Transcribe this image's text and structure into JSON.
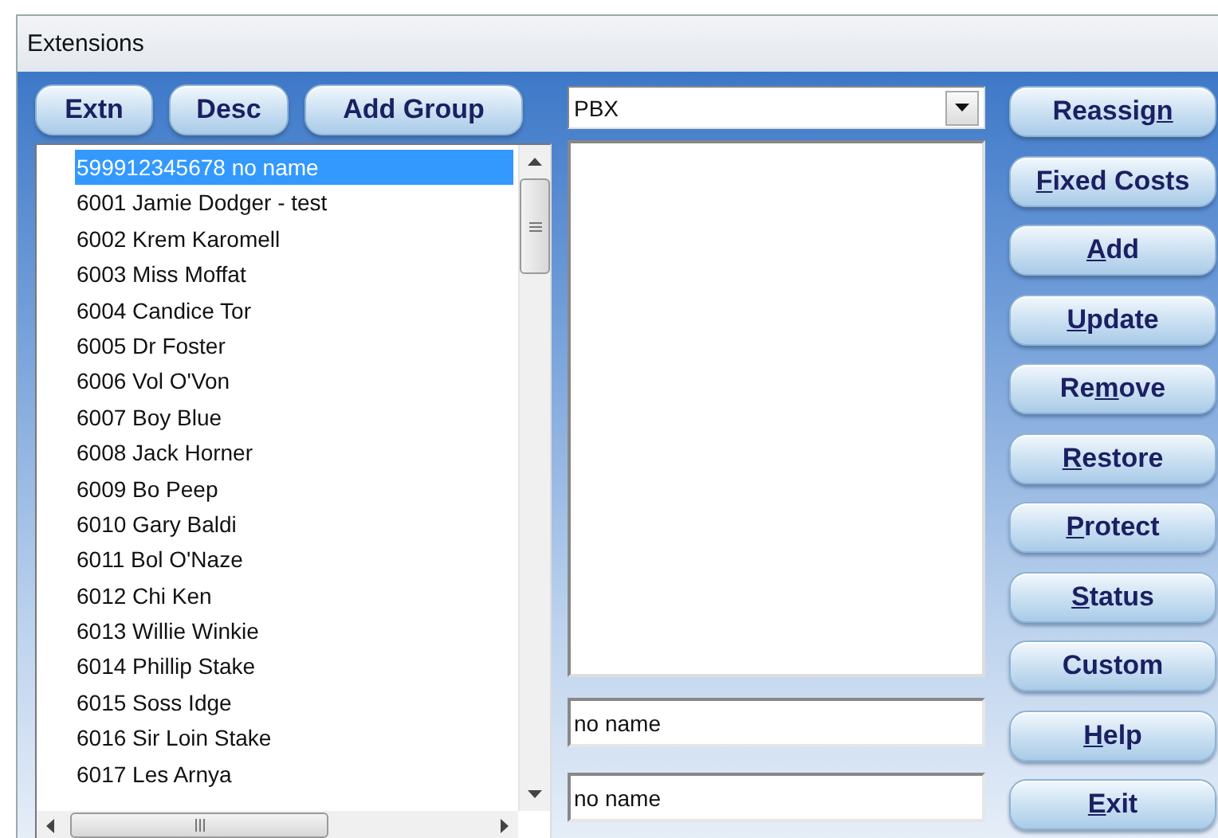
{
  "window": {
    "title": "Extensions"
  },
  "sort_buttons": [
    "Extn",
    "Desc",
    "Add Group"
  ],
  "extensions": [
    {
      "label": "599912345678 no name",
      "selected": true
    },
    {
      "label": "6001 Jamie Dodger - test",
      "selected": false
    },
    {
      "label": "6002 Krem Karomell",
      "selected": false
    },
    {
      "label": "6003 Miss Moffat",
      "selected": false
    },
    {
      "label": "6004 Candice Tor",
      "selected": false
    },
    {
      "label": "6005 Dr Foster",
      "selected": false
    },
    {
      "label": "6006 Vol O'Von",
      "selected": false
    },
    {
      "label": "6007 Boy Blue",
      "selected": false
    },
    {
      "label": "6008 Jack Horner",
      "selected": false
    },
    {
      "label": "6009 Bo Peep",
      "selected": false
    },
    {
      "label": "6010 Gary Baldi",
      "selected": false
    },
    {
      "label": "6011 Bol O'Naze",
      "selected": false
    },
    {
      "label": "6012 Chi Ken",
      "selected": false
    },
    {
      "label": "6013 Willie Winkie",
      "selected": false
    },
    {
      "label": "6014 Phillip Stake",
      "selected": false
    },
    {
      "label": "6015 Soss Idge",
      "selected": false
    },
    {
      "label": "6016 Sir Loin Stake",
      "selected": false
    },
    {
      "label": "6017 Les Arnya",
      "selected": false
    }
  ],
  "type_dropdown": {
    "value": "PBX"
  },
  "description_field": {
    "value": "no name"
  },
  "name_field": {
    "value": "no name"
  },
  "action_buttons": [
    {
      "before": "Reassig",
      "key": "n"
    },
    {
      "key": "F",
      "after": "ixed Costs"
    },
    {
      "key": "A",
      "after": "dd"
    },
    {
      "key": "U",
      "after": "pdate"
    },
    {
      "before": "Re",
      "key": "m",
      "after": "ove"
    },
    {
      "key": "R",
      "after": "estore"
    },
    {
      "key": "P",
      "after": "rotect"
    },
    {
      "key": "S",
      "after": "tatus"
    },
    {
      "before": "Custom"
    },
    {
      "key": "H",
      "after": "elp"
    },
    {
      "key": "E",
      "after": "xit"
    }
  ]
}
